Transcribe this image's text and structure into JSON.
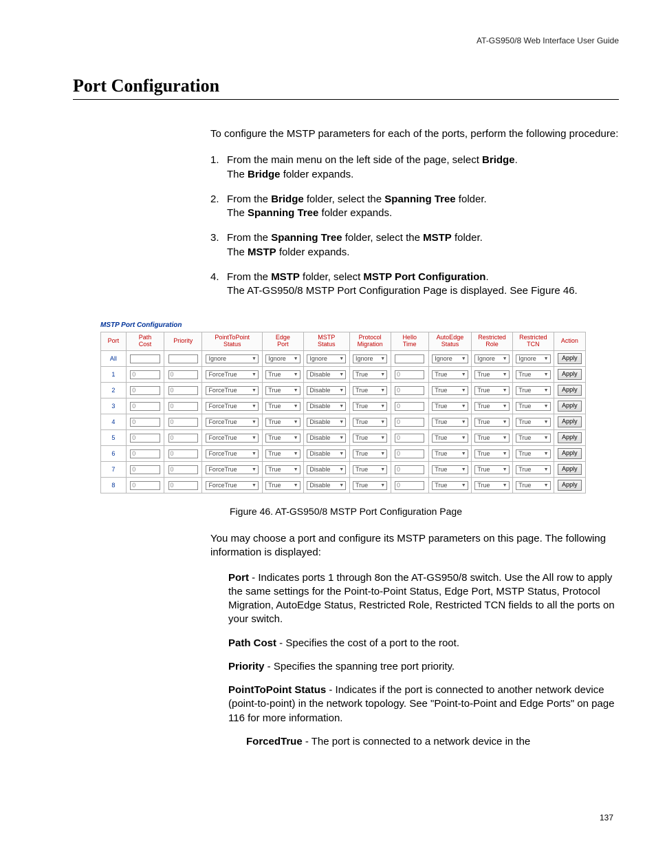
{
  "header": {
    "running": "AT-GS950/8  Web Interface User Guide"
  },
  "title": "Port Configuration",
  "intro": "To configure the MSTP parameters for each of the ports, perform the following procedure:",
  "steps": [
    {
      "num": "1.",
      "pre": "From the main menu on the left side of the page, select ",
      "b1": "Bridge",
      "post": ".",
      "line2pre": "The ",
      "line2b": "Bridge",
      "line2post": " folder expands."
    },
    {
      "num": "2.",
      "pre": "From the ",
      "b1": "Bridge",
      "post": " folder, select the ",
      "b2": "Spanning Tree",
      "post2": " folder.",
      "line2pre": "The ",
      "line2b": "Spanning Tree",
      "line2post": " folder expands."
    },
    {
      "num": "3.",
      "pre": "From the ",
      "b1": "Spanning Tree",
      "post": " folder, select the ",
      "b2": "MSTP",
      "post2": " folder.",
      "line2pre": "The ",
      "line2b": "MSTP",
      "line2post": " folder expands."
    },
    {
      "num": "4.",
      "pre": "From the ",
      "b1": "MSTP",
      "post": " folder, select ",
      "b2": "MSTP Port Configuration",
      "post2": ".",
      "line2pre": "The AT-GS950/8 MSTP Port Configuration Page is displayed. See Figure 46.",
      "line2b": "",
      "line2post": ""
    }
  ],
  "figure": {
    "title": "MSTP Port Configuration",
    "headers": [
      "Port",
      "Path Cost",
      "Priority",
      "PointToPoint Status",
      "Edge Port",
      "MSTP Status",
      "Protocol Migration",
      "Hello Time",
      "AutoEdge Status",
      "Restricted Role",
      "Restricted TCN",
      "Action"
    ],
    "all_row": {
      "port": "All",
      "p2p": "Ignore",
      "edge": "Ignore",
      "mstp": "Ignore",
      "mig": "Ignore",
      "auto": "Ignore",
      "rrole": "Ignore",
      "rtcn": "Ignore",
      "btn": "Apply"
    },
    "rows": [
      {
        "port": "1",
        "path": "0",
        "prio": "0",
        "p2p": "ForceTrue",
        "edge": "True",
        "mstp": "Disable",
        "mig": "True",
        "hello": "0",
        "auto": "True",
        "rrole": "True",
        "rtcn": "True",
        "btn": "Apply"
      },
      {
        "port": "2",
        "path": "0",
        "prio": "0",
        "p2p": "ForceTrue",
        "edge": "True",
        "mstp": "Disable",
        "mig": "True",
        "hello": "0",
        "auto": "True",
        "rrole": "True",
        "rtcn": "True",
        "btn": "Apply"
      },
      {
        "port": "3",
        "path": "0",
        "prio": "0",
        "p2p": "ForceTrue",
        "edge": "True",
        "mstp": "Disable",
        "mig": "True",
        "hello": "0",
        "auto": "True",
        "rrole": "True",
        "rtcn": "True",
        "btn": "Apply"
      },
      {
        "port": "4",
        "path": "0",
        "prio": "0",
        "p2p": "ForceTrue",
        "edge": "True",
        "mstp": "Disable",
        "mig": "True",
        "hello": "0",
        "auto": "True",
        "rrole": "True",
        "rtcn": "True",
        "btn": "Apply"
      },
      {
        "port": "5",
        "path": "0",
        "prio": "0",
        "p2p": "ForceTrue",
        "edge": "True",
        "mstp": "Disable",
        "mig": "True",
        "hello": "0",
        "auto": "True",
        "rrole": "True",
        "rtcn": "True",
        "btn": "Apply"
      },
      {
        "port": "6",
        "path": "0",
        "prio": "0",
        "p2p": "ForceTrue",
        "edge": "True",
        "mstp": "Disable",
        "mig": "True",
        "hello": "0",
        "auto": "True",
        "rrole": "True",
        "rtcn": "True",
        "btn": "Apply"
      },
      {
        "port": "7",
        "path": "0",
        "prio": "0",
        "p2p": "ForceTrue",
        "edge": "True",
        "mstp": "Disable",
        "mig": "True",
        "hello": "0",
        "auto": "True",
        "rrole": "True",
        "rtcn": "True",
        "btn": "Apply"
      },
      {
        "port": "8",
        "path": "0",
        "prio": "0",
        "p2p": "ForceTrue",
        "edge": "True",
        "mstp": "Disable",
        "mig": "True",
        "hello": "0",
        "auto": "True",
        "rrole": "True",
        "rtcn": "True",
        "btn": "Apply"
      }
    ]
  },
  "caption": "Figure 46. AT-GS950/8 MSTP Port Configuration Page",
  "desc": {
    "intro": "You may choose a port and configure its MSTP parameters on this page. The following information is displayed:",
    "items": [
      {
        "b": "Port",
        "t": " - Indicates ports 1 through 8on the AT-GS950/8 switch. Use the All row to apply the same settings for the Point-to-Point Status, Edge Port, MSTP Status, Protocol Migration, AutoEdge Status, Restricted Role, Restricted TCN fields to all the ports on your switch."
      },
      {
        "b": "Path Cost",
        "t": " - Specifies the cost of a port to the root."
      },
      {
        "b": "Priority",
        "t": " - Specifies the spanning tree port priority."
      },
      {
        "b": "PointToPoint Status",
        "t": " - Indicates if the port is connected to another network device (point-to-point) in the network topology. See \"Point-to-Point and Edge Ports\" on page 116 for more information."
      }
    ],
    "sub": {
      "b": "ForcedTrue",
      "t": " - The port is connected to a network device in the"
    }
  },
  "page_number": "137"
}
